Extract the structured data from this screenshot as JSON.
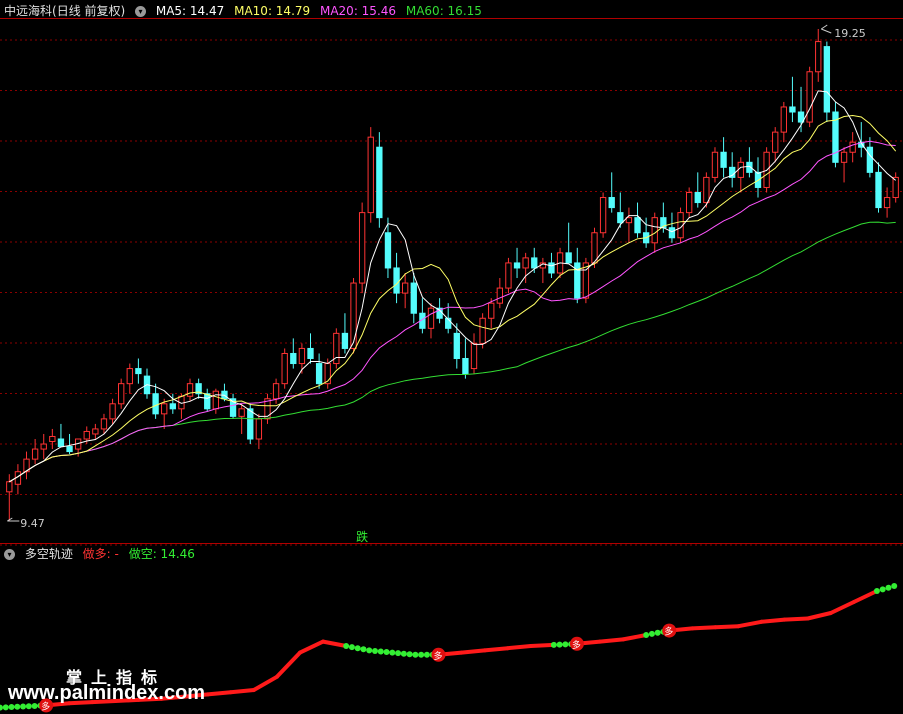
{
  "colors": {
    "up": "#ff3333",
    "down": "#54fcfc",
    "ma5": "#ffffff",
    "ma10": "#ffff66",
    "ma20": "#ff55ff",
    "ma60": "#33dd33",
    "grid": "#8b0000",
    "traj_long": "#ff1a1a",
    "traj_short": "#33ee33"
  },
  "header": {
    "stock": "中远海科",
    "mode": "(日线 前复权)",
    "ma5_label": "MA5: 14.47",
    "ma10_label": "MA10: 14.79",
    "ma20_label": "MA20: 15.46",
    "ma60_label": "MA60: 16.15"
  },
  "annotations": {
    "high_label": "19.25",
    "low_label": "9.47",
    "signal_label": "跌"
  },
  "sub_header": {
    "indicator": "多空轨迹",
    "long_label": "做多: -",
    "short_label": "做空: 14.46"
  },
  "watermark": {
    "line1": "掌上指标",
    "line2": "www.palmindex.com"
  },
  "markers": {
    "long_glyph": "多"
  },
  "chart_data": [
    {
      "type": "candlestick",
      "title": "中远海科",
      "high": 19.25,
      "low": 9.47,
      "bars": [
        [
          10.05,
          10.4,
          9.47,
          10.25
        ],
        [
          10.2,
          10.6,
          10.0,
          10.45
        ],
        [
          10.45,
          10.85,
          10.3,
          10.7
        ],
        [
          10.7,
          11.1,
          10.6,
          10.9
        ],
        [
          10.9,
          11.2,
          10.7,
          11.0
        ],
        [
          11.05,
          11.3,
          10.9,
          11.15
        ],
        [
          11.1,
          11.4,
          11.0,
          10.95
        ],
        [
          10.95,
          11.2,
          10.8,
          10.85
        ],
        [
          10.9,
          11.1,
          10.75,
          11.1
        ],
        [
          11.1,
          11.35,
          11.0,
          11.25
        ],
        [
          11.2,
          11.4,
          11.1,
          11.3
        ],
        [
          11.3,
          11.6,
          11.2,
          11.5
        ],
        [
          11.5,
          11.9,
          11.4,
          11.8
        ],
        [
          11.8,
          12.3,
          11.7,
          12.2
        ],
        [
          12.2,
          12.6,
          12.0,
          12.5
        ],
        [
          12.5,
          12.7,
          12.2,
          12.4
        ],
        [
          12.35,
          12.5,
          11.9,
          12.0
        ],
        [
          12.0,
          12.2,
          11.5,
          11.6
        ],
        [
          11.6,
          11.9,
          11.3,
          11.8
        ],
        [
          11.8,
          12.0,
          11.6,
          11.7
        ],
        [
          11.7,
          12.0,
          11.5,
          11.95
        ],
        [
          11.95,
          12.3,
          11.85,
          12.2
        ],
        [
          12.2,
          12.3,
          11.9,
          12.0
        ],
        [
          12.0,
          12.1,
          11.65,
          11.7
        ],
        [
          11.7,
          12.1,
          11.6,
          12.05
        ],
        [
          12.05,
          12.2,
          11.85,
          11.9
        ],
        [
          11.9,
          12.0,
          11.5,
          11.55
        ],
        [
          11.55,
          11.8,
          11.2,
          11.7
        ],
        [
          11.7,
          11.8,
          11.0,
          11.1
        ],
        [
          11.1,
          11.6,
          10.9,
          11.5
        ],
        [
          11.5,
          12.0,
          11.4,
          11.9
        ],
        [
          11.9,
          12.3,
          11.8,
          12.2
        ],
        [
          12.2,
          12.9,
          12.1,
          12.8
        ],
        [
          12.8,
          13.1,
          12.5,
          12.6
        ],
        [
          12.6,
          13.0,
          12.4,
          12.9
        ],
        [
          12.9,
          13.2,
          12.6,
          12.7
        ],
        [
          12.6,
          12.8,
          12.1,
          12.2
        ],
        [
          12.2,
          12.7,
          12.1,
          12.6
        ],
        [
          12.6,
          13.3,
          12.5,
          13.2
        ],
        [
          13.2,
          13.6,
          12.8,
          12.9
        ],
        [
          12.9,
          14.3,
          12.8,
          14.2
        ],
        [
          14.2,
          15.8,
          14.0,
          15.6
        ],
        [
          15.6,
          17.3,
          15.4,
          17.1
        ],
        [
          16.9,
          17.2,
          15.3,
          15.5
        ],
        [
          15.2,
          15.5,
          14.3,
          14.5
        ],
        [
          14.5,
          14.8,
          13.8,
          14.0
        ],
        [
          14.0,
          14.4,
          13.7,
          14.2
        ],
        [
          14.2,
          14.4,
          13.4,
          13.6
        ],
        [
          13.6,
          13.9,
          13.2,
          13.3
        ],
        [
          13.3,
          13.8,
          13.1,
          13.7
        ],
        [
          13.7,
          13.9,
          13.4,
          13.5
        ],
        [
          13.5,
          13.8,
          13.2,
          13.3
        ],
        [
          13.2,
          13.4,
          12.5,
          12.7
        ],
        [
          12.7,
          13.1,
          12.3,
          12.4
        ],
        [
          12.5,
          13.2,
          12.4,
          13.0
        ],
        [
          13.0,
          13.6,
          12.9,
          13.5
        ],
        [
          13.5,
          13.9,
          13.3,
          13.8
        ],
        [
          13.8,
          14.3,
          13.7,
          14.1
        ],
        [
          14.1,
          14.7,
          14.0,
          14.6
        ],
        [
          14.6,
          14.9,
          14.3,
          14.5
        ],
        [
          14.5,
          14.8,
          14.2,
          14.7
        ],
        [
          14.7,
          14.9,
          14.4,
          14.5
        ],
        [
          14.5,
          14.7,
          14.2,
          14.6
        ],
        [
          14.6,
          14.8,
          14.3,
          14.4
        ],
        [
          14.4,
          14.9,
          14.3,
          14.8
        ],
        [
          14.8,
          15.4,
          14.6,
          14.6
        ],
        [
          14.6,
          14.9,
          13.8,
          13.9
        ],
        [
          13.9,
          14.7,
          13.8,
          14.6
        ],
        [
          14.6,
          15.3,
          14.5,
          15.2
        ],
        [
          15.2,
          16.0,
          15.1,
          15.9
        ],
        [
          15.9,
          16.4,
          15.6,
          15.7
        ],
        [
          15.6,
          16.0,
          15.3,
          15.4
        ],
        [
          15.4,
          15.7,
          15.0,
          15.5
        ],
        [
          15.5,
          15.8,
          15.1,
          15.2
        ],
        [
          15.2,
          15.5,
          14.9,
          15.0
        ],
        [
          15.0,
          15.6,
          14.8,
          15.5
        ],
        [
          15.5,
          15.8,
          15.2,
          15.3
        ],
        [
          15.3,
          15.6,
          15.0,
          15.1
        ],
        [
          15.1,
          15.7,
          15.0,
          15.6
        ],
        [
          15.6,
          16.1,
          15.5,
          16.0
        ],
        [
          16.0,
          16.4,
          15.7,
          15.8
        ],
        [
          15.8,
          16.4,
          15.7,
          16.3
        ],
        [
          16.3,
          16.9,
          16.2,
          16.8
        ],
        [
          16.8,
          17.1,
          16.3,
          16.5
        ],
        [
          16.5,
          16.8,
          16.1,
          16.3
        ],
        [
          16.3,
          16.7,
          16.0,
          16.6
        ],
        [
          16.6,
          16.9,
          16.3,
          16.4
        ],
        [
          16.4,
          16.7,
          15.9,
          16.1
        ],
        [
          16.1,
          16.9,
          16.0,
          16.8
        ],
        [
          16.8,
          17.3,
          16.6,
          17.2
        ],
        [
          17.2,
          17.8,
          17.0,
          17.7
        ],
        [
          17.7,
          18.3,
          17.4,
          17.6
        ],
        [
          17.6,
          18.1,
          17.2,
          17.4
        ],
        [
          17.4,
          18.5,
          17.3,
          18.4
        ],
        [
          18.4,
          19.25,
          18.2,
          19.0
        ],
        [
          18.9,
          19.0,
          17.4,
          17.6
        ],
        [
          17.6,
          17.8,
          16.5,
          16.6
        ],
        [
          16.6,
          16.9,
          16.2,
          16.8
        ],
        [
          16.8,
          17.2,
          16.6,
          17.0
        ],
        [
          17.0,
          17.4,
          16.7,
          16.9
        ],
        [
          16.9,
          17.1,
          16.3,
          16.4
        ],
        [
          16.4,
          16.6,
          15.6,
          15.7
        ],
        [
          15.7,
          16.1,
          15.5,
          15.9
        ],
        [
          15.9,
          16.4,
          15.8,
          16.3
        ]
      ],
      "ma_series": [
        "MA5",
        "MA10",
        "MA20",
        "MA60"
      ]
    },
    {
      "type": "line",
      "title": "多空轨迹",
      "series": [
        {
          "name": "做多",
          "values": [
            10.0,
            10.05,
            10.1,
            10.2,
            10.25,
            10.3,
            10.35,
            10.4,
            10.5,
            10.6,
            10.7,
            10.8,
            11.4,
            12.5,
            13.0,
            12.8,
            12.6,
            12.5,
            12.4,
            12.4,
            12.5,
            12.6,
            12.7,
            12.8,
            12.85,
            12.9,
            13.0,
            13.1,
            13.3,
            13.5,
            13.6,
            13.65,
            13.7,
            13.9,
            14.0,
            14.05,
            14.3,
            14.8,
            15.3,
            15.6
          ]
        },
        {
          "name": "做空",
          "values": [
            14.46
          ]
        }
      ]
    }
  ]
}
